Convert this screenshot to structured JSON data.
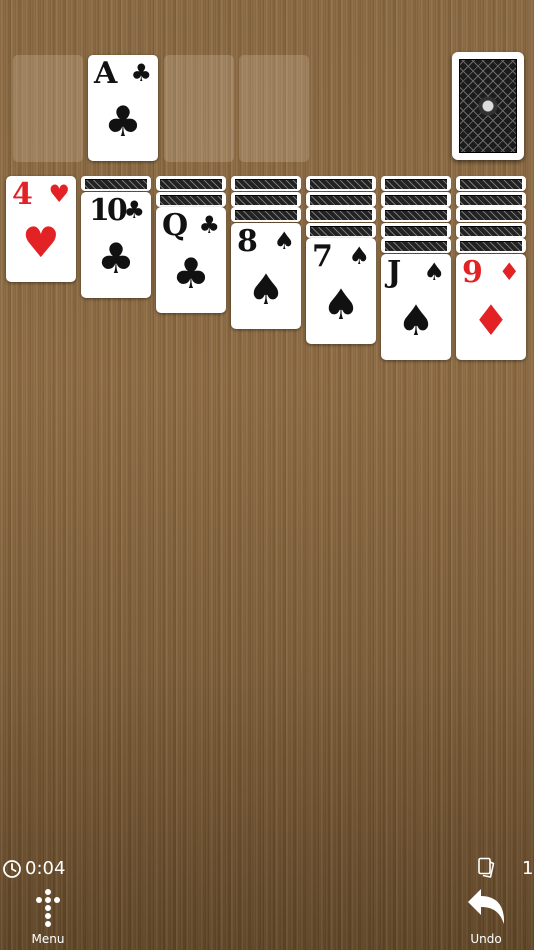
{
  "foundation": {
    "card": {
      "rank": "A",
      "suit": "♣",
      "color": "black"
    }
  },
  "tableau": [
    {
      "face_down": 0,
      "rank": "4",
      "suit": "♥",
      "color": "red"
    },
    {
      "face_down": 1,
      "rank": "10",
      "suit": "♣",
      "color": "black"
    },
    {
      "face_down": 2,
      "rank": "Q",
      "suit": "♣",
      "color": "black"
    },
    {
      "face_down": 3,
      "rank": "8",
      "suit": "♠",
      "color": "black"
    },
    {
      "face_down": 4,
      "rank": "7",
      "suit": "♠",
      "color": "black"
    },
    {
      "face_down": 5,
      "rank": "J",
      "suit": "♠",
      "color": "black"
    },
    {
      "face_down": 5,
      "rank": "9",
      "suit": "♦",
      "color": "red"
    }
  ],
  "status": {
    "timer": "0:04",
    "moves": "1"
  },
  "toolbar": {
    "menu_label": "Menu",
    "undo_label": "Undo"
  },
  "icons": {
    "timer": "clock-icon",
    "moves": "cards-icon",
    "menu": "menu-icon",
    "undo": "undo-arrow-icon"
  },
  "colors": {
    "red": "#e32226",
    "black": "#111111"
  }
}
